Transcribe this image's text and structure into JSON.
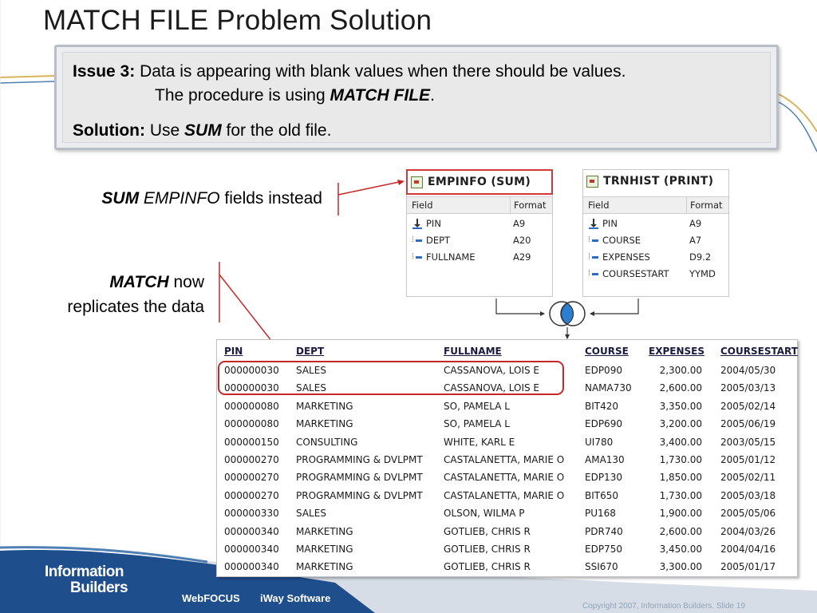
{
  "slide": {
    "title": "MATCH FILE Problem Solution"
  },
  "issue": {
    "issue_label": "Issue 3:",
    "issue_text": "Data is appearing with blank values when there should be values.",
    "issue_text2_pre": "The procedure is using ",
    "issue_text2_em": "MATCH FILE",
    "issue_text2_post": ".",
    "solution_label": "Solution:",
    "solution_pre": "Use ",
    "solution_em": "SUM",
    "solution_post": " for the old file."
  },
  "notes": {
    "note1_bi": "SUM",
    "note1_it": "EMPINFO",
    "note1_rest": " fields instead",
    "note2_bi": "MATCH",
    "note2_rest": " now",
    "note2_line2": "replicates the data"
  },
  "panels": {
    "left": {
      "title": "EMPINFO (SUM)",
      "col_field": "Field",
      "col_format": "Format",
      "rows": [
        {
          "name": "PIN",
          "format": "A9",
          "icon": "key-icon"
        },
        {
          "name": "DEPT",
          "format": "A20",
          "icon": "field-icon"
        },
        {
          "name": "FULLNAME",
          "format": "A29",
          "icon": "field-icon"
        }
      ]
    },
    "right": {
      "title": "TRNHIST (PRINT)",
      "col_field": "Field",
      "col_format": "Format",
      "rows": [
        {
          "name": "PIN",
          "format": "A9",
          "icon": "key-icon"
        },
        {
          "name": "COURSE",
          "format": "A7",
          "icon": "field-icon"
        },
        {
          "name": "EXPENSES",
          "format": "D9.2",
          "icon": "field-icon"
        },
        {
          "name": "COURSESTART",
          "format": "YYMD",
          "icon": "field-icon"
        }
      ]
    }
  },
  "report": {
    "headers": [
      "PIN",
      "DEPT",
      "FULLNAME",
      "COURSE",
      "EXPENSES",
      "COURSESTART"
    ],
    "rows": [
      [
        "000000030",
        "SALES",
        "CASSANOVA, LOIS E",
        "EDP090",
        "2,300.00",
        "2004/05/30"
      ],
      [
        "000000030",
        "SALES",
        "CASSANOVA, LOIS E",
        "NAMA730",
        "2,600.00",
        "2005/03/13"
      ],
      [
        "000000080",
        "MARKETING",
        "SO, PAMELA L",
        "BIT420",
        "3,350.00",
        "2005/02/14"
      ],
      [
        "000000080",
        "MARKETING",
        "SO, PAMELA L",
        "EDP690",
        "3,200.00",
        "2005/06/19"
      ],
      [
        "000000150",
        "CONSULTING",
        "WHITE, KARL E",
        "UI780",
        "3,400.00",
        "2003/05/15"
      ],
      [
        "000000270",
        "PROGRAMMING & DVLPMT",
        "CASTALANETTA, MARIE O",
        "AMA130",
        "1,730.00",
        "2005/01/12"
      ],
      [
        "000000270",
        "PROGRAMMING & DVLPMT",
        "CASTALANETTA, MARIE O",
        "EDP130",
        "1,850.00",
        "2005/02/11"
      ],
      [
        "000000270",
        "PROGRAMMING & DVLPMT",
        "CASTALANETTA, MARIE O",
        "BIT650",
        "1,730.00",
        "2005/03/18"
      ],
      [
        "000000330",
        "SALES",
        "OLSON, WILMA P",
        "PU168",
        "1,900.00",
        "2005/05/06"
      ],
      [
        "000000340",
        "MARKETING",
        "GOTLIEB, CHRIS R",
        "PDR740",
        "2,600.00",
        "2004/03/26"
      ],
      [
        "000000340",
        "MARKETING",
        "GOTLIEB, CHRIS R",
        "EDP750",
        "3,450.00",
        "2004/04/16"
      ],
      [
        "000000340",
        "MARKETING",
        "GOTLIEB, CHRIS R",
        "SSI670",
        "3,300.00",
        "2005/01/17"
      ]
    ]
  },
  "footer": {
    "brand_line1": "Information",
    "brand_line2": "Builders",
    "product1": "WebFOCUS",
    "product2": "iWay Software",
    "copyright": "Copyright 2007, Information Builders. Slide 19"
  },
  "colors": {
    "accent_red": "#c62828",
    "footer_blue": "#1f4e8c",
    "deco_gold": "#d9b45a",
    "deco_blue": "#4f7fb3"
  }
}
